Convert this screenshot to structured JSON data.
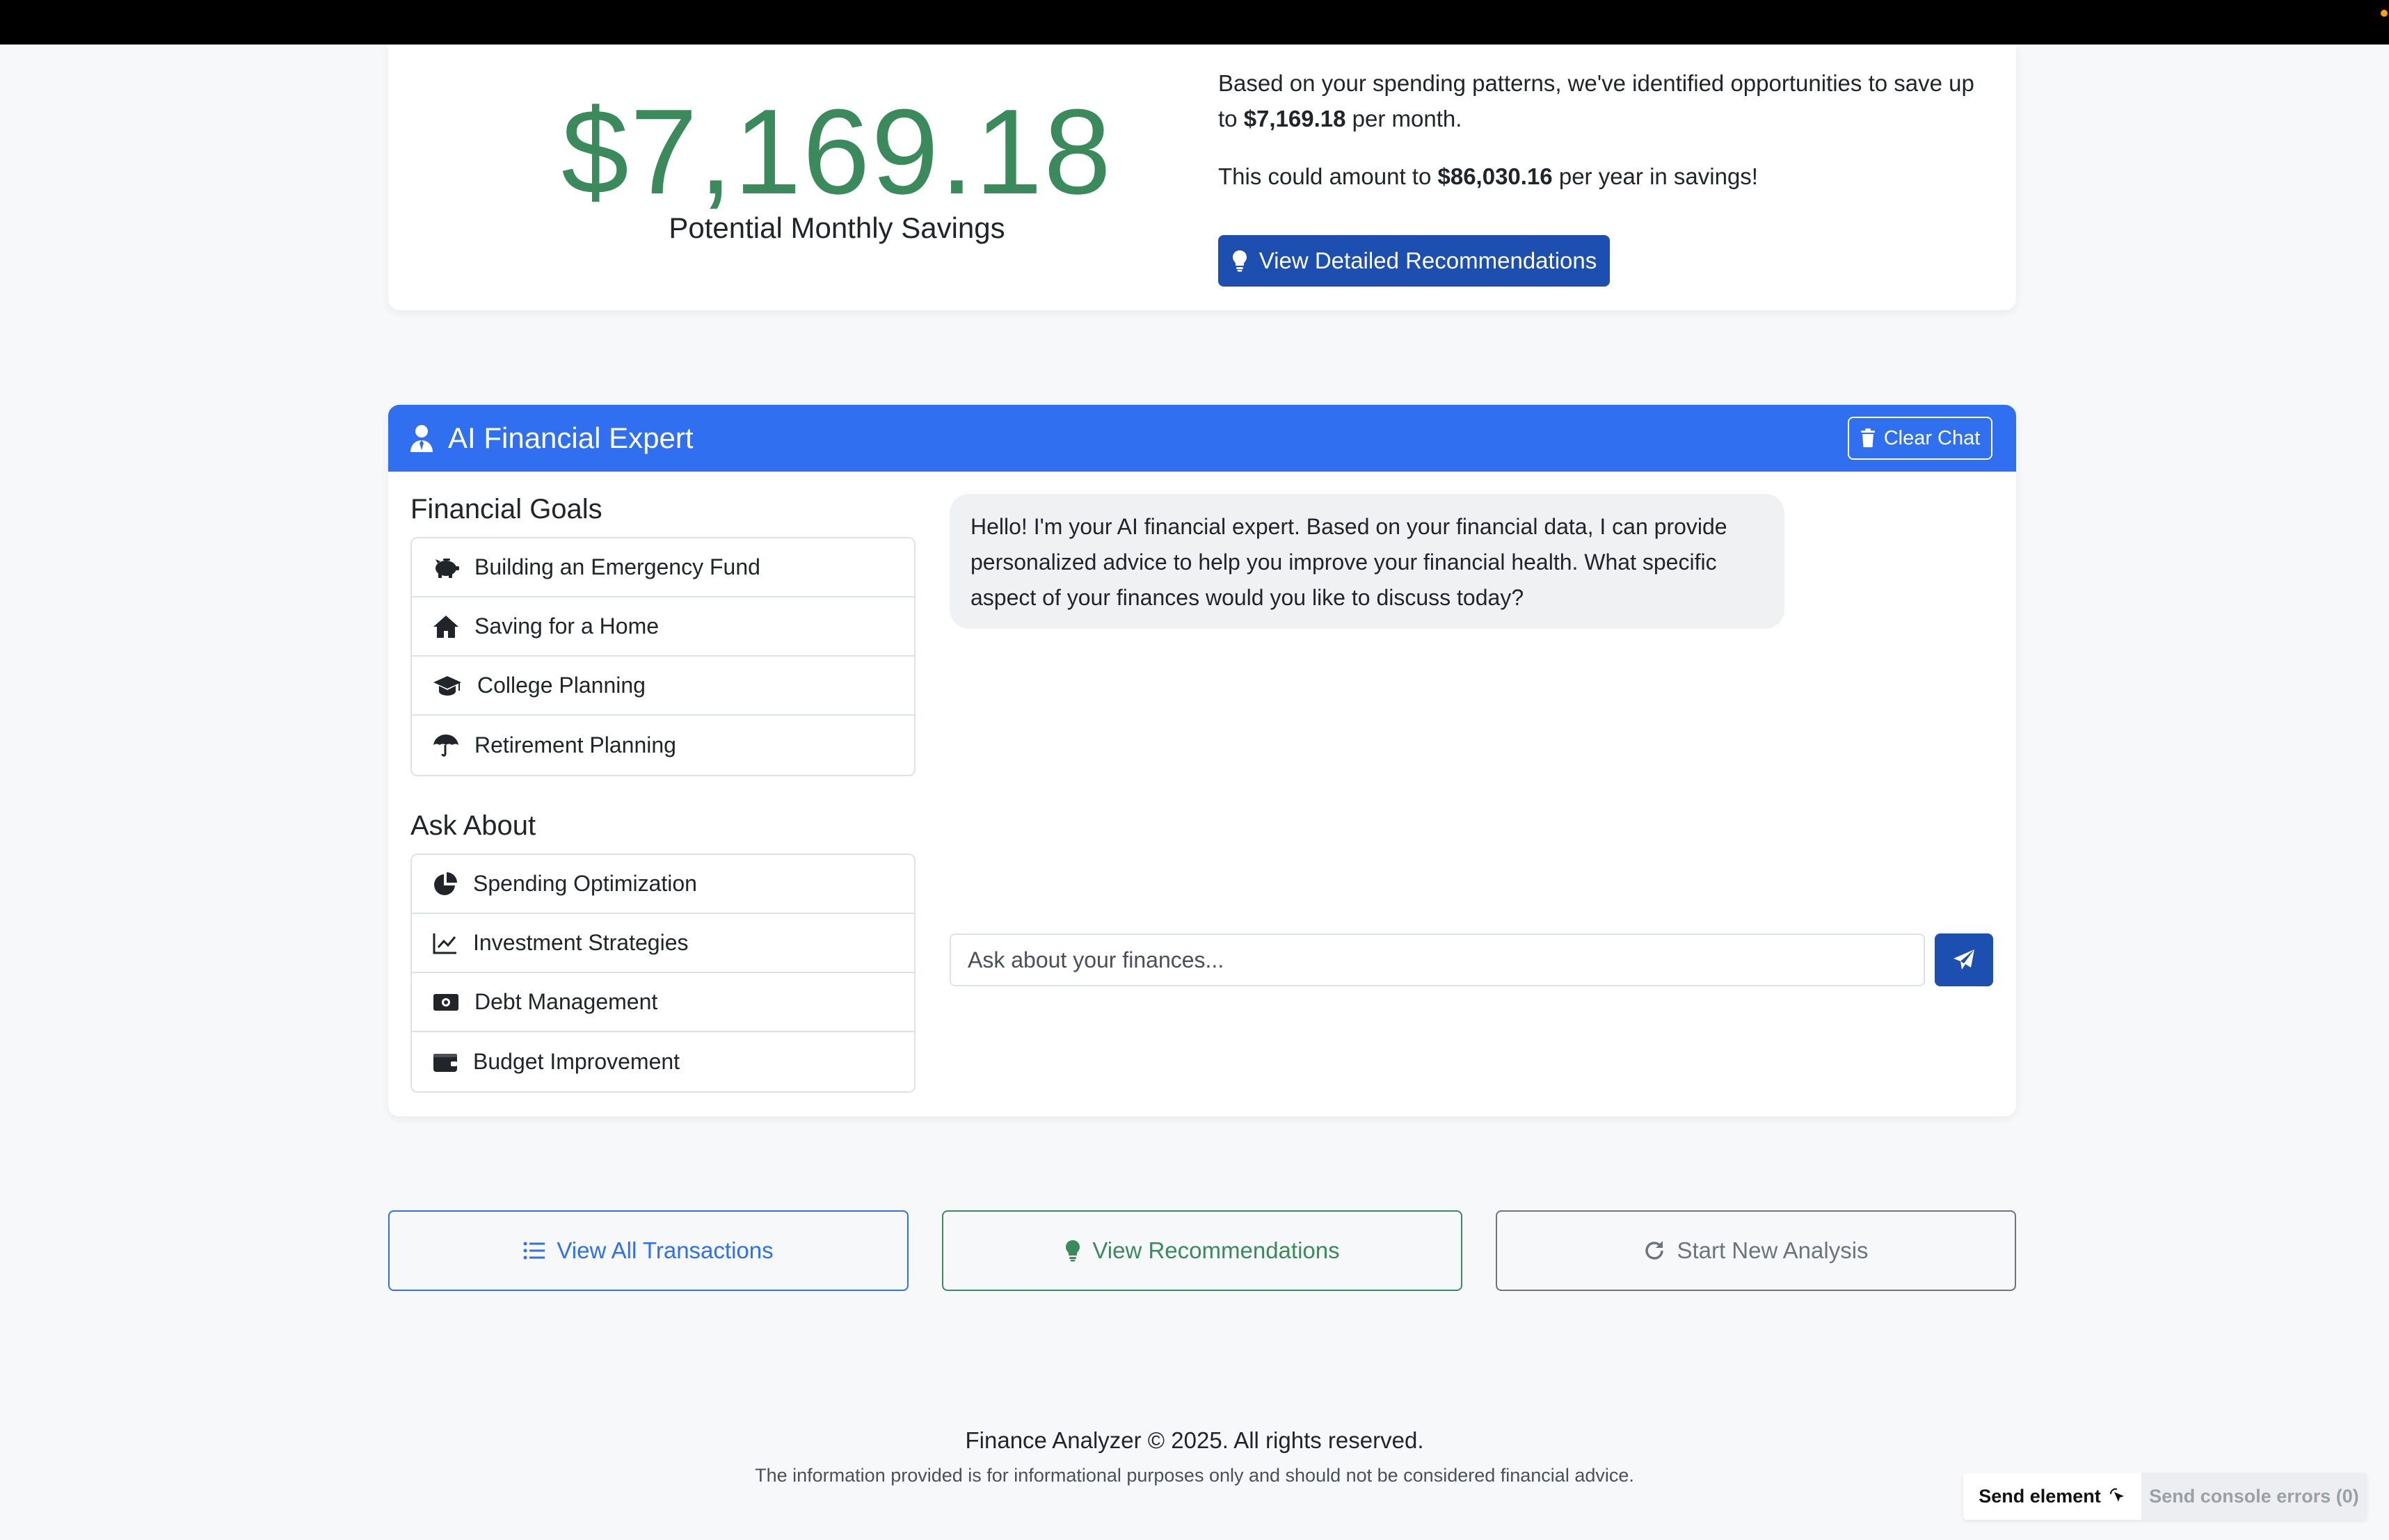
{
  "savings": {
    "amount": "$7,169.18",
    "label": "Potential Monthly Savings",
    "line1_pre": "Based on your spending patterns, we've identified opportunities to save up to ",
    "line1_amount": "$7,169.18",
    "line1_post": " per month.",
    "line2_pre": "This could amount to ",
    "line2_amount": "$86,030.16",
    "line2_post": " per year in savings!",
    "button": "View Detailed Recommendations"
  },
  "chat": {
    "title": "AI Financial Expert",
    "clear": "Clear Chat",
    "message": "Hello! I'm your AI financial expert. Based on your financial data, I can provide personalized advice to help you improve your financial health. What specific aspect of your finances would you like to discuss today?",
    "placeholder": "Ask about your finances..."
  },
  "goals": {
    "title": "Financial Goals",
    "items": [
      {
        "label": "Building an Emergency Fund",
        "icon": "piggy-bank-icon"
      },
      {
        "label": "Saving for a Home",
        "icon": "house-icon"
      },
      {
        "label": "College Planning",
        "icon": "graduation-cap-icon"
      },
      {
        "label": "Retirement Planning",
        "icon": "umbrella-icon"
      }
    ]
  },
  "ask": {
    "title": "Ask About",
    "items": [
      {
        "label": "Spending Optimization",
        "icon": "pie-chart-icon"
      },
      {
        "label": "Investment Strategies",
        "icon": "line-chart-icon"
      },
      {
        "label": "Debt Management",
        "icon": "money-bill-icon"
      },
      {
        "label": "Budget Improvement",
        "icon": "wallet-icon"
      }
    ]
  },
  "actions": {
    "transactions": "View All Transactions",
    "recommendations": "View Recommendations",
    "new_analysis": "Start New Analysis"
  },
  "footer": {
    "line1": "Finance Analyzer © 2025. All rights reserved.",
    "line2": "The information provided is for informational purposes only and should not be considered financial advice."
  },
  "devtools": {
    "send_element": "Send element",
    "send_errors": "Send console errors (0)"
  },
  "colors": {
    "primary": "#3070f0",
    "primary_dark": "#1c4fb0",
    "success": "#3a8a5c",
    "secondary": "#6c757d"
  }
}
